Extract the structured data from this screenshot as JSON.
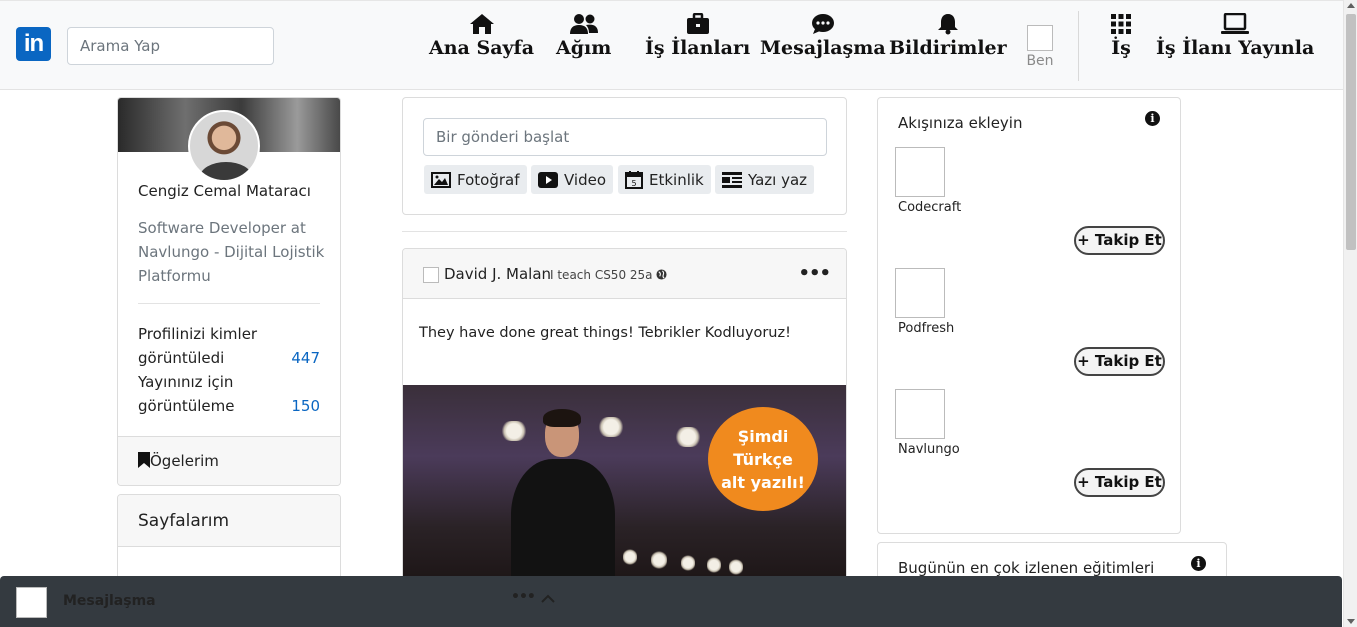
{
  "header": {
    "logo_text": "in",
    "search_placeholder": "Arama Yap",
    "nav": [
      {
        "label": "Ana Sayfa",
        "icon": "home-icon"
      },
      {
        "label": "Ağım",
        "icon": "users-icon"
      },
      {
        "label": "İş İlanları",
        "icon": "briefcase-icon"
      },
      {
        "label": "Mesajlaşma",
        "icon": "chat-icon"
      },
      {
        "label": "Bildirimler",
        "icon": "bell-icon"
      }
    ],
    "me_label": "Ben",
    "work_label": "İş",
    "post_job_label": "İş İlanı Yayınla",
    "brand_color": "#0a66c2"
  },
  "profile": {
    "name": "Cengiz Cemal Mataracı",
    "title": "Software Developer at Navlungo - Dijital Lojistik Platformu",
    "stats": [
      {
        "label": "Profilinizi kimler görüntüledi",
        "value": "447"
      },
      {
        "label": "Yayınınız için görüntüleme",
        "value": "150"
      }
    ],
    "items_label": "Ögelerim"
  },
  "pages": {
    "title": "Sayfalarım"
  },
  "composer": {
    "placeholder": "Bir gönderi başlat",
    "buttons": [
      {
        "label": "Fotoğraf",
        "icon": "photo-icon"
      },
      {
        "label": "Video",
        "icon": "video-icon"
      },
      {
        "label": "Etkinlik",
        "icon": "calendar-icon"
      },
      {
        "label": "Yazı yaz",
        "icon": "article-icon"
      }
    ]
  },
  "post": {
    "author": "David J. Malan",
    "subtitle": "I teach CS50",
    "time": "25a",
    "text": "They have done great things! Tebrikler Kodluyoruz!",
    "image_badge": [
      "Şimdi",
      "Türkçe",
      "alt yazılı!"
    ]
  },
  "follow": {
    "title": "Akışınıza ekleyin",
    "button_label": "+ Takip Et",
    "items": [
      "Codecraft",
      "Podfresh",
      "Navlungo"
    ]
  },
  "trending": {
    "title": "Bugünün en çok izlenen eğitimleri"
  },
  "messaging": {
    "label": "Mesajlaşma",
    "dots": "•••"
  }
}
